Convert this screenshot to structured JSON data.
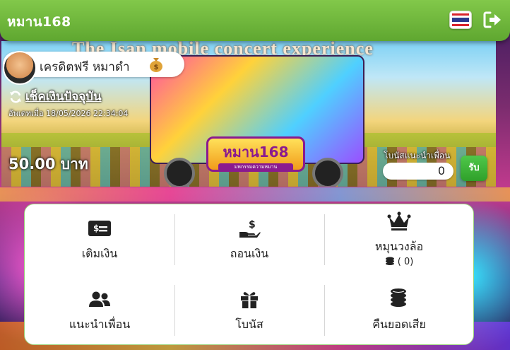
{
  "header": {
    "brand": "หมาน168",
    "language": "Thai",
    "accent_color": "#6bb83a"
  },
  "banner": {
    "headline": "The Isan mobile concert experience",
    "logo_text": "หมาน168",
    "logo_sub": "มหกรรมความหมาน"
  },
  "profile": {
    "username": "เครดิตฟรี หมาดำ",
    "wallet_icon": "money-bag-icon"
  },
  "wallet": {
    "refresh_label": "เช็คเงินปัจจุบัน",
    "updated_text": "อัพเดทเมื่อ 18/05/2026 22:34:04",
    "balance": "50.00 บาท"
  },
  "referral": {
    "label": "โบนัสแนะนำเพื่อน",
    "value": "0",
    "claim_label": "รับ"
  },
  "menu": {
    "items": [
      {
        "label": "เติมเงิน",
        "icon": "deposit-card-icon"
      },
      {
        "label": "ถอนเงิน",
        "icon": "withdraw-hand-icon"
      },
      {
        "label": "หมุนวงล้อ",
        "icon": "crown-icon",
        "sub": "( 0)"
      },
      {
        "label": "แนะนำเพื่อน",
        "icon": "users-icon"
      },
      {
        "label": "โบนัส",
        "icon": "gift-icon"
      },
      {
        "label": "คืนยอดเสีย",
        "icon": "coins-icon"
      }
    ]
  }
}
